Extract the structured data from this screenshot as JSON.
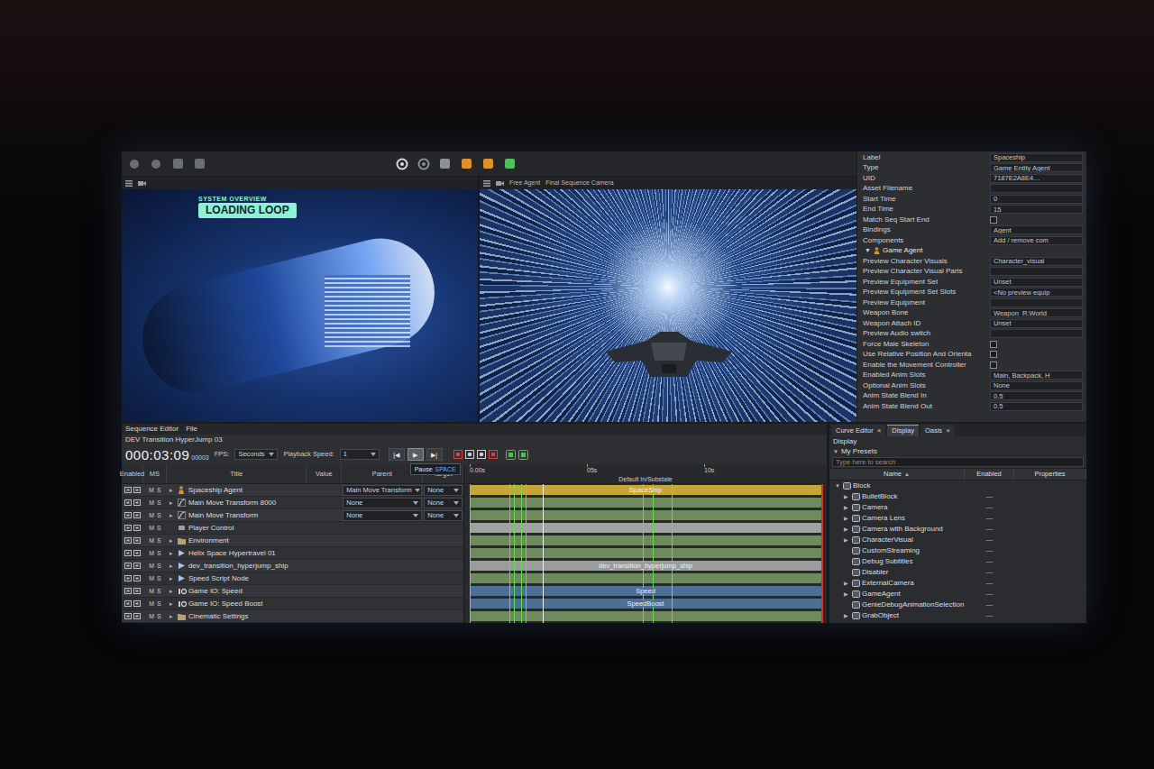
{
  "slide_badge": {
    "kicker": "SYSTEM OVERVIEW",
    "title": "LOADING LOOP"
  },
  "viewport": {
    "agent": "Free Agent",
    "camera": "Final Sequence Camera"
  },
  "properties": [
    {
      "kind": "text",
      "label": "Label",
      "value": "Spaceship"
    },
    {
      "kind": "text",
      "label": "Type",
      "value": "Game Entity Agent"
    },
    {
      "kind": "text",
      "label": "UID",
      "value": "7187E2A8E4…"
    },
    {
      "kind": "text",
      "label": "Asset Filename",
      "value": ""
    },
    {
      "kind": "text",
      "label": "Start Time",
      "value": "0"
    },
    {
      "kind": "text",
      "label": "End Time",
      "value": "15"
    },
    {
      "kind": "checkbox",
      "label": "Match Seq Start End",
      "checked": false
    },
    {
      "kind": "text",
      "label": "Bindings",
      "value": "Agent"
    },
    {
      "kind": "text",
      "label": "Components",
      "value": "Add / remove com"
    },
    {
      "kind": "header",
      "toggle": "▼",
      "label": "Game Agent"
    },
    {
      "kind": "text",
      "label": "Preview Character Visuals",
      "value": "Character_visual"
    },
    {
      "kind": "text",
      "label": "Preview Character Visual Parts",
      "value": ""
    },
    {
      "kind": "text",
      "label": "Preview Equipment Set",
      "value": "Unset"
    },
    {
      "kind": "text",
      "label": "Preview Equipment Set Slots",
      "value": "<No preview equip"
    },
    {
      "kind": "text",
      "label": "Preview Equipment",
      "value": ""
    },
    {
      "kind": "text",
      "label": "Weapon Bone",
      "value": "Weapon_R:World"
    },
    {
      "kind": "text",
      "label": "Weapon Attach ID",
      "value": "Unset"
    },
    {
      "kind": "text",
      "label": "Preview Audio switch",
      "value": ""
    },
    {
      "kind": "checkbox",
      "label": "Force Male Skeleton",
      "checked": false
    },
    {
      "kind": "checkbox",
      "label": "Use Relative Position And Orienta",
      "checked": false
    },
    {
      "kind": "checkbox",
      "label": "Enable the Movement Controller",
      "checked": false
    },
    {
      "kind": "text",
      "label": "Enabled Anim Slots",
      "value": "Main, Backpack, H"
    },
    {
      "kind": "text",
      "label": "Optional Anim Slots",
      "value": "None"
    },
    {
      "kind": "text",
      "label": "Anim State Blend In",
      "value": "0.5"
    },
    {
      "kind": "text",
      "label": "Anim State Blend Out",
      "value": "0.5"
    }
  ],
  "sequence_editor": {
    "menu": [
      "Sequence Editor",
      "File"
    ],
    "sequence_name": "DEV Transition HyperJump 03",
    "timecode": "000:03:09",
    "frame": "00003",
    "fps": {
      "label": "FPS:",
      "value": "Seconds"
    },
    "playback_speed": {
      "label": "Playback Speed:",
      "value": "1"
    },
    "transport": [
      {
        "icon": "|◀",
        "selected": false
      },
      {
        "icon": "▶",
        "selected": true
      },
      {
        "icon": "▶|",
        "selected": false
      }
    ],
    "tooltip": {
      "label": "Pause",
      "key": "SPACE"
    },
    "columns": [
      "Enabled",
      "MS",
      "Title",
      "Value",
      "Parent",
      "Target"
    ],
    "ms": [
      "M",
      "S"
    ],
    "rows": [
      {
        "kind": "agent",
        "arrow": "▸",
        "title": "Spaceship Agent",
        "parent": "Main Move Transform",
        "target": "None"
      },
      {
        "kind": "transform",
        "arrow": "▸",
        "title": "Main Move Transform 8000",
        "parent": "None",
        "target": "None"
      },
      {
        "kind": "transform",
        "arrow": "▸",
        "title": "Main Move Transform",
        "parent": "None",
        "target": "None"
      },
      {
        "kind": "control",
        "arrow": "",
        "title": "Player Control",
        "parent": "",
        "target": ""
      },
      {
        "kind": "folder",
        "arrow": "▸",
        "title": "Environment",
        "parent": "",
        "target": ""
      },
      {
        "kind": "node",
        "arrow": "▸",
        "title": "Helix Space Hypertravel 01",
        "parent": "",
        "target": ""
      },
      {
        "kind": "node",
        "arrow": "▸",
        "title": "dev_transition_hyperjump_ship",
        "parent": "",
        "target": ""
      },
      {
        "kind": "node",
        "arrow": "▸",
        "title": "Speed Script Node",
        "parent": "",
        "target": ""
      },
      {
        "kind": "io",
        "arrow": "▸",
        "title": "Game IO: Speed",
        "parent": "",
        "target": ""
      },
      {
        "kind": "io",
        "arrow": "▸",
        "title": "Game IO: Speed Boost",
        "parent": "",
        "target": ""
      },
      {
        "kind": "folder",
        "arrow": "▸",
        "title": "Cinematic Settings",
        "parent": "",
        "target": ""
      }
    ],
    "timeline": {
      "duration_s": 15,
      "playhead_s": 3.1,
      "ticks": [
        {
          "label": "0.00s",
          "s": 0
        },
        {
          "label": "05s",
          "s": 5
        },
        {
          "label": "10s",
          "s": 10
        }
      ],
      "marker": {
        "label": "Default In/Substate",
        "s": 7.5
      },
      "keys_s": [
        0,
        1.7,
        1.9,
        2.2,
        2.4,
        7.4,
        7.8,
        8.6
      ],
      "tracks": [
        {
          "clip": "SpaceShip",
          "color": "#c6a637"
        },
        {
          "clip": "",
          "color": "#6f8a5c"
        },
        {
          "clip": "",
          "color": "#6f8a5c"
        },
        {
          "clip": "",
          "color": "#9ea39d"
        },
        {
          "clip": "",
          "color": "#6f8a5c"
        },
        {
          "clip": "",
          "color": "#6f8a5c"
        },
        {
          "clip": "dev_transition_hyperjump_ship",
          "color": "#9a9e9b"
        },
        {
          "clip": "",
          "color": "#6f8a5c"
        },
        {
          "clip": "Speed",
          "color": "#4d6f93"
        },
        {
          "clip": "SpeedBoost",
          "color": "#4d6f93"
        },
        {
          "clip": "",
          "color": "#6f8a5c"
        }
      ]
    }
  },
  "curve_panel": {
    "tabs": [
      {
        "label": "Curve Editor",
        "close": "×",
        "selected": false
      },
      {
        "label": "Display",
        "close": "",
        "selected": true
      },
      {
        "label": "Oasis",
        "close": "×",
        "selected": false
      }
    ],
    "section": "Display",
    "presets": {
      "arrow": "▼",
      "label": "My Presets"
    },
    "search": {
      "placeholder": "Type here to search"
    },
    "columns": [
      {
        "label": "Name",
        "sort": "▲"
      },
      {
        "label": "Enabled",
        "sort": ""
      },
      {
        "label": "Properties",
        "sort": ""
      }
    ],
    "tree": [
      {
        "depth": 0,
        "arrow": "▼",
        "name": "Block",
        "enabled": ""
      },
      {
        "depth": 1,
        "arrow": "▶",
        "name": "BulletBlock",
        "enabled": "—"
      },
      {
        "depth": 1,
        "arrow": "▶",
        "name": "Camera",
        "enabled": "—"
      },
      {
        "depth": 1,
        "arrow": "▶",
        "name": "Camera Lens",
        "enabled": "—"
      },
      {
        "depth": 1,
        "arrow": "▶",
        "name": "Camera with Background",
        "enabled": "—"
      },
      {
        "depth": 1,
        "arrow": "▶",
        "name": "CharacterVisual",
        "enabled": "—"
      },
      {
        "depth": 1,
        "arrow": "",
        "name": "CustomStreaming",
        "enabled": "—"
      },
      {
        "depth": 1,
        "arrow": "",
        "name": "Debug Subtitles",
        "enabled": "—"
      },
      {
        "depth": 1,
        "arrow": "",
        "name": "Disabler",
        "enabled": "—"
      },
      {
        "depth": 1,
        "arrow": "▶",
        "name": "ExternalCamera",
        "enabled": "—"
      },
      {
        "depth": 1,
        "arrow": "▶",
        "name": "GameAgent",
        "enabled": "—"
      },
      {
        "depth": 1,
        "arrow": "",
        "name": "GenieDebugAnimationSelection",
        "enabled": "—"
      },
      {
        "depth": 1,
        "arrow": "▶",
        "name": "GrabObject",
        "enabled": "—"
      }
    ]
  }
}
